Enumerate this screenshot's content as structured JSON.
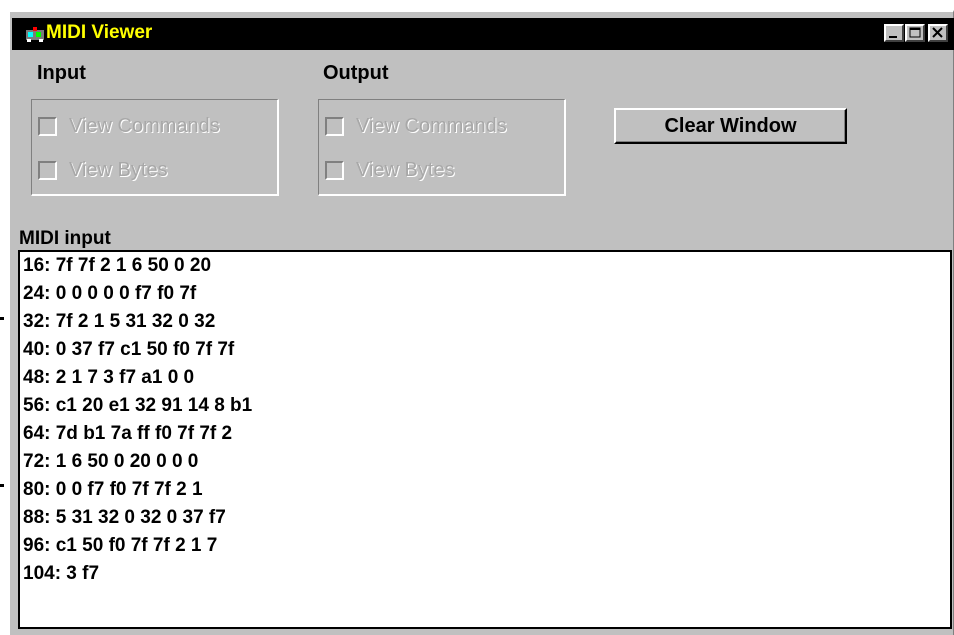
{
  "window": {
    "title": "MIDI Viewer"
  },
  "input_group": {
    "label": "Input",
    "view_commands": "View Commands",
    "view_bytes": "View Bytes"
  },
  "output_group": {
    "label": "Output",
    "view_commands": "View Commands",
    "view_bytes": "View Bytes"
  },
  "clear_button": "Clear Window",
  "midi_input": {
    "label": "MIDI input",
    "lines": [
      "16: 7f 7f 2 1 6 50 0 20",
      "24: 0 0 0 0 0 f7 f0 7f",
      "32: 7f 2 1 5 31 32 0 32",
      "40: 0 37 f7 c1 50 f0 7f 7f",
      "48: 2 1 7 3 f7 a1 0 0",
      "56: c1 20 e1 32 91 14 8 b1",
      "64: 7d b1 7a ff f0 7f 7f 2",
      "72: 1 6 50 0 20 0 0 0",
      "80: 0 0 f7 f0 7f 7f 2 1",
      "88: 5 31 32 0 32 0 37 f7",
      "96: c1 50 f0 7f 7f 2 1 7",
      "104: 3 f7"
    ]
  },
  "colors": {
    "titlebar": "#000000",
    "title_text": "#ffff00",
    "face": "#c0c0c0"
  },
  "icons": [
    "app-icon",
    "minimize-icon",
    "maximize-icon",
    "close-icon"
  ]
}
